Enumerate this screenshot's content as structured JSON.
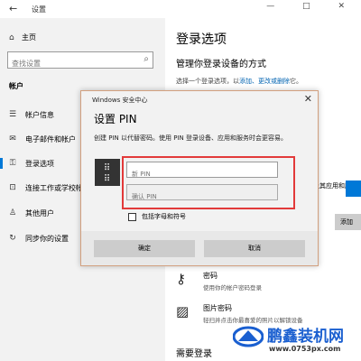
{
  "titlebar": {
    "back": "←",
    "title": "设置",
    "controls": "— □ ✕"
  },
  "sidebar": {
    "home": "主页",
    "search_placeholder": "查找设置",
    "section": "帐户",
    "items": [
      {
        "label": "帐户信息",
        "icon": "person-card-icon"
      },
      {
        "label": "电子邮件和帐户",
        "icon": "mail-icon"
      },
      {
        "label": "登录选项",
        "icon": "key-icon"
      },
      {
        "label": "连接工作或学校帐户",
        "icon": "briefcase-icon"
      },
      {
        "label": "其他用户",
        "icon": "person-add-icon"
      },
      {
        "label": "同步你的设置",
        "icon": "sync-icon"
      }
    ]
  },
  "main": {
    "title": "登录选项",
    "subhead": "管理你登录设备的方式",
    "hint_prefix": "选择一个登录选项，以",
    "hint_links": "添加、更改或删除",
    "hint_suffix": "它。",
    "peek_text": "及其应用和服",
    "add_button": "添加",
    "options": [
      {
        "title": "密码",
        "desc": "使用你的帐户密码登录"
      },
      {
        "title": "图片密码",
        "desc": "轻扫并点击你最喜爱的照片以解锁设备"
      }
    ],
    "need_login": "需要登录"
  },
  "dialog": {
    "caption": "Windows 安全中心",
    "close": "✕",
    "title": "设置 PIN",
    "description": "创建 PIN 以代替密码。使用 PIN 登录设备、应用和服务时会更容易。",
    "new_pin_placeholder": "新 PIN",
    "confirm_pin_placeholder": "确认 PIN",
    "checkbox_label": "包括字母和符号",
    "ok": "确定",
    "cancel": "取消"
  },
  "watermark": {
    "text": "鹏鑫装机网",
    "url": "www.0753px.com"
  },
  "colors": {
    "accent": "#0078d7",
    "highlight": "#e23a3a",
    "sidebar_bg": "#f2f2f2"
  }
}
